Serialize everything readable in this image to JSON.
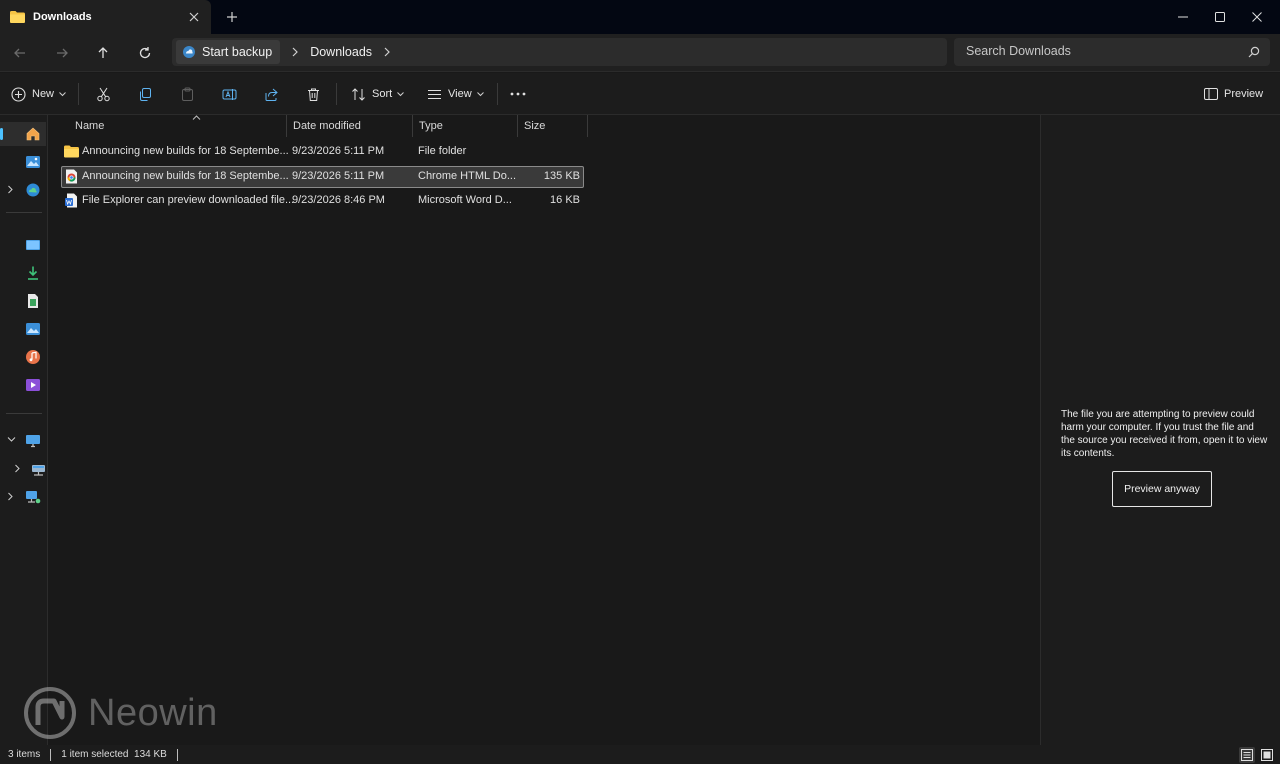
{
  "window": {
    "tab_title": "Downloads",
    "colors": {
      "accent": "#4cc2ff",
      "folder": "#f6c445"
    }
  },
  "address": {
    "home_crumb": "Start backup",
    "crumbs": [
      "Downloads"
    ]
  },
  "search": {
    "placeholder": "Search Downloads"
  },
  "commandbar": {
    "new_label": "New",
    "sort_label": "Sort",
    "view_label": "View",
    "preview_label": "Preview"
  },
  "filelist": {
    "columns": {
      "name": "Name",
      "date": "Date modified",
      "type": "Type",
      "size": "Size"
    },
    "rows": [
      {
        "name": "Announcing new builds for 18 Septembe...",
        "date": "9/23/2026 5:11 PM",
        "type": "File folder",
        "size": "",
        "icon": "folder-icon"
      },
      {
        "name": "Announcing new builds for 18 Septembe...",
        "date": "9/23/2026 5:11 PM",
        "type": "Chrome HTML Do...",
        "size": "135 KB",
        "icon": "chrome-html-icon",
        "selected": true
      },
      {
        "name": "File Explorer can preview downloaded file...",
        "date": "9/23/2026 8:46 PM",
        "type": "Microsoft Word D...",
        "size": "16 KB",
        "icon": "word-document-icon"
      }
    ]
  },
  "preview": {
    "message": "The file you are attempting to preview could harm your computer. If you trust the file and the source you received it from, open it to view its contents.",
    "button_label": "Preview anyway"
  },
  "status": {
    "item_count": "3 items",
    "selection": "1 item selected  134 KB"
  },
  "watermark": {
    "text": "Neowin"
  }
}
